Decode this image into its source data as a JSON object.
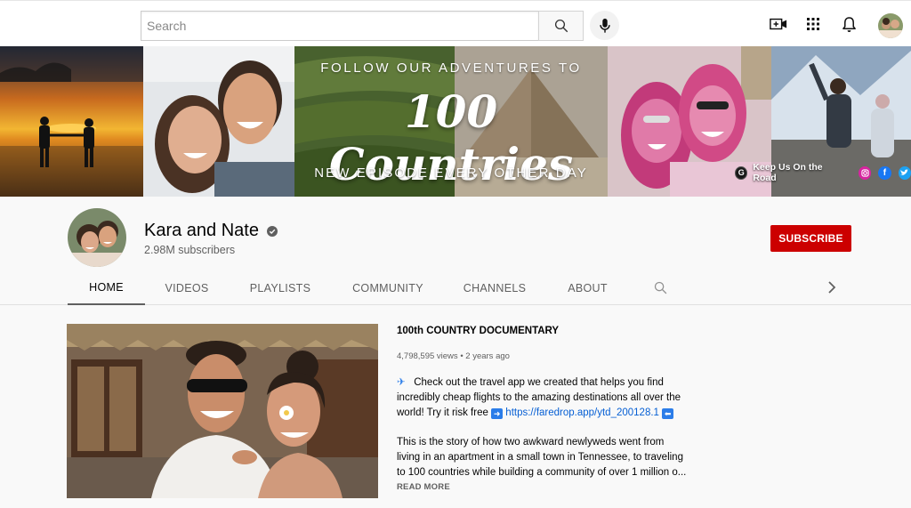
{
  "search": {
    "placeholder": "Search",
    "value": ""
  },
  "topbar_icons": [
    "search-icon",
    "microphone-icon",
    "create-video-icon",
    "apps-grid-icon",
    "notifications-bell-icon",
    "account-avatar"
  ],
  "banner": {
    "line_top": "FOLLOW OUR ADVENTURES TO",
    "headline": "100 Countries",
    "line_bottom": "NEW EPISODE EVERY OTHER DAY",
    "link_label": "Keep Us On the Road",
    "link_badge": "G",
    "socials": [
      "instagram-icon",
      "facebook-icon",
      "twitter-icon"
    ]
  },
  "channel": {
    "name": "Kara and Nate",
    "subscribers": "2.98M subscribers",
    "subscribe_label": "SUBSCRIBE",
    "tabs": [
      {
        "label": "HOME",
        "active": true
      },
      {
        "label": "VIDEOS",
        "active": false
      },
      {
        "label": "PLAYLISTS",
        "active": false
      },
      {
        "label": "COMMUNITY",
        "active": false
      },
      {
        "label": "CHANNELS",
        "active": false
      },
      {
        "label": "ABOUT",
        "active": false
      }
    ]
  },
  "featured": {
    "title": "100th COUNTRY DOCUMENTARY",
    "views": "4,798,595 views",
    "age": "2 years ago",
    "desc_intro": "Check out the travel app we created that helps you find incredibly cheap flights to the amazing destinations all over the world! Try it risk free",
    "desc_link": "https://faredrop.app/ytd_200128.1",
    "desc_p2_line1": "This is the story of how two awkward newlyweds went from",
    "desc_p2_line2": "living in an apartment in a small town in Tennessee, to traveling",
    "desc_p2_line3": "to 100 countries while building a community of over 1 million o...",
    "read_more": "READ MORE"
  },
  "colors": {
    "brand_red": "#cc0000",
    "link_blue": "#065fd4",
    "muted_text": "#606060"
  }
}
